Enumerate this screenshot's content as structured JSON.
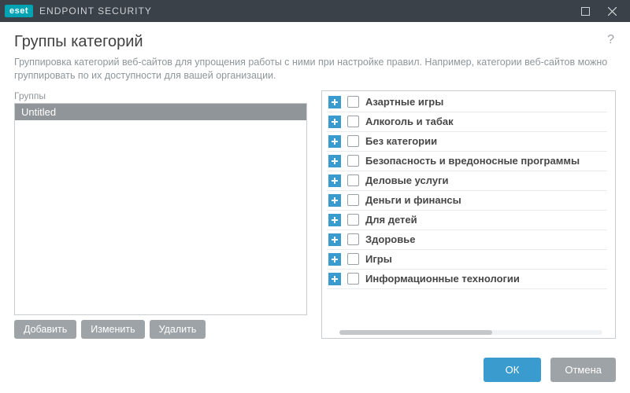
{
  "brand": {
    "logo": "eset",
    "product": "ENDPOINT SECURITY"
  },
  "heading": "Группы категорий",
  "help_glyph": "?",
  "description": "Группировка категорий веб-сайтов для упрощения работы с ними при настройке правил. Например, категории веб-сайтов можно группировать по их доступности для вашей организации.",
  "groups_label": "Группы",
  "groups": {
    "items": [
      "Untitled"
    ],
    "selected_index": 0,
    "buttons": {
      "add": "Добавить",
      "edit": "Изменить",
      "delete": "Удалить"
    }
  },
  "categories": [
    {
      "label": "Азартные игры",
      "checked": false
    },
    {
      "label": "Алкоголь и табак",
      "checked": false
    },
    {
      "label": "Без категории",
      "checked": false
    },
    {
      "label": "Безопасность и вредоносные программы",
      "checked": false
    },
    {
      "label": "Деловые услуги",
      "checked": false
    },
    {
      "label": "Деньги и финансы",
      "checked": false
    },
    {
      "label": "Для детей",
      "checked": false
    },
    {
      "label": "Здоровье",
      "checked": false
    },
    {
      "label": "Игры",
      "checked": false
    },
    {
      "label": "Информационные технологии",
      "checked": false
    }
  ],
  "footer": {
    "ok": "ОК",
    "cancel": "Отмена"
  },
  "colors": {
    "accent": "#3a9bcf",
    "brand": "#00a3b4",
    "titlebar": "#3b4148",
    "gray_btn": "#9da3a7"
  }
}
